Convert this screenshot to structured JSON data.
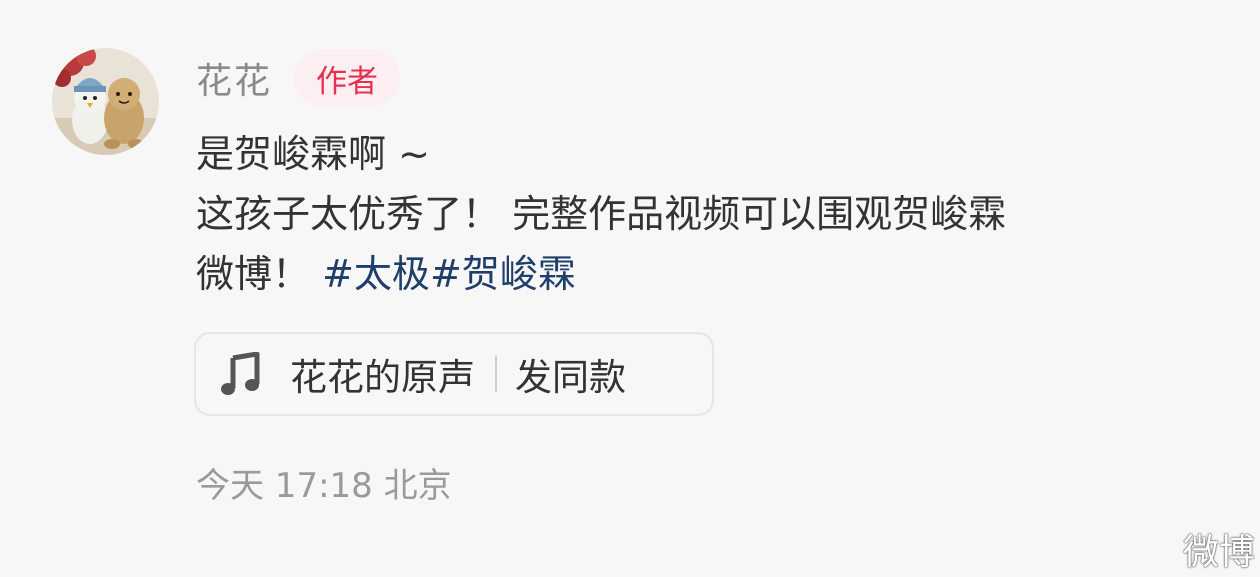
{
  "comment": {
    "username": "花花",
    "author_badge": "作者",
    "lines": {
      "line1": "是贺峻霖啊 ~",
      "line2": "这孩子太优秀了！ 完整作品视频可以围观贺峻霖",
      "line3_text": "微博！ ",
      "hashtag1": "#太极",
      "hashtag2": "#贺峻霖"
    },
    "sound": {
      "icon": "music-note-icon",
      "title": "花花的原声",
      "action": "发同款"
    },
    "meta": "今天 17:18 北京"
  },
  "watermark": "微博",
  "colors": {
    "background": "#f7f7f7",
    "badge_bg": "#fdeff1",
    "badge_text": "#e5334f",
    "hashtag": "#1f3f6a",
    "username": "#8a8a8a",
    "meta": "#9a9a9a"
  }
}
